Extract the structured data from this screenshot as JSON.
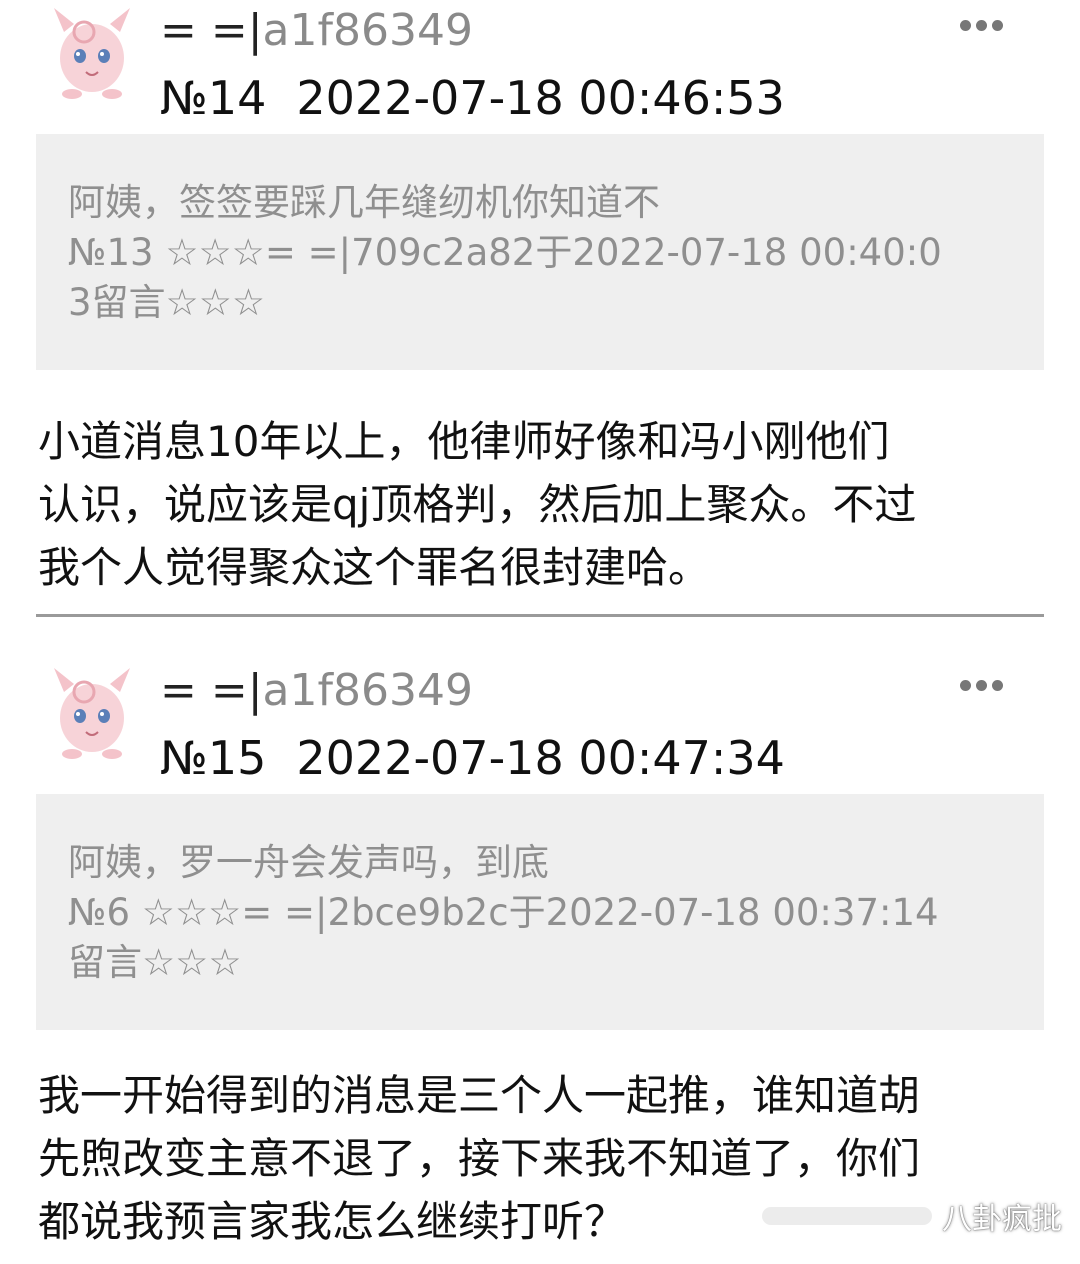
{
  "posts": [
    {
      "avatar_icon": "pink-character-avatar-icon",
      "user_prefix": "= =|",
      "user_id": "a1f86349",
      "number": "№14",
      "timestamp": "2022-07-18 00:46:53",
      "quote_lines": [
        "阿姨，签签要踩几年缝纫机你知道不",
        "№13 ☆☆☆= =|709c2a82于2022-07-18 00:40:0",
        "3留言☆☆☆"
      ],
      "body_lines": [
        "小道消息10年以上，他律师好像和冯小刚他们",
        "认识，说应该是qj顶格判，然后加上聚众。不过",
        "我个人觉得聚众这个罪名很封建哈。"
      ]
    },
    {
      "avatar_icon": "pink-character-avatar-icon",
      "user_prefix": "= =|",
      "user_id": "a1f86349",
      "number": "№15",
      "timestamp": "2022-07-18 00:47:34",
      "quote_lines": [
        "阿姨，罗一舟会发声吗，到底",
        "№6 ☆☆☆= =|2bce9b2c于2022-07-18 00:37:14",
        "留言☆☆☆"
      ],
      "body_lines": [
        "我一开始得到的消息是三个人一起推，谁知道胡",
        "先煦改变主意不退了，接下来我不知道了，你们",
        "都说我预言家我怎么继续打听？"
      ]
    }
  ],
  "more_icon": "more-dots-icon",
  "watermark": "八卦疯批"
}
